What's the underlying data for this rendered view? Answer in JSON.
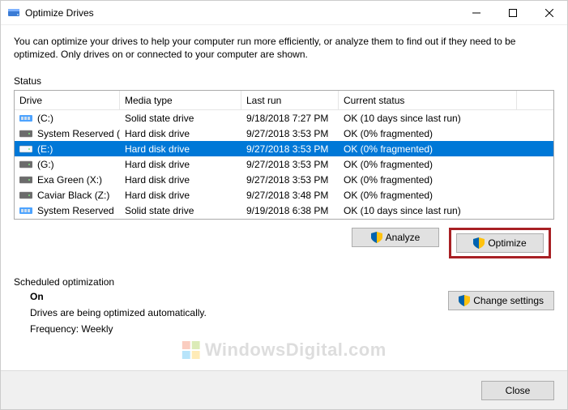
{
  "window": {
    "title": "Optimize Drives"
  },
  "description": "You can optimize your drives to help your computer run more efficiently, or analyze them to find out if they need to be optimized. Only drives on or connected to your computer are shown.",
  "status_label": "Status",
  "columns": {
    "drive": "Drive",
    "media": "Media type",
    "last": "Last run",
    "status": "Current status"
  },
  "rows": [
    {
      "icon": "ssd",
      "drive": "(C:)",
      "media": "Solid state drive",
      "last": "9/18/2018 7:27 PM",
      "status": "OK (10 days since last run)",
      "selected": false
    },
    {
      "icon": "hdd",
      "drive": "System Reserved (D:)",
      "media": "Hard disk drive",
      "last": "9/27/2018 3:53 PM",
      "status": "OK (0% fragmented)",
      "selected": false
    },
    {
      "icon": "hdd",
      "drive": "(E:)",
      "media": "Hard disk drive",
      "last": "9/27/2018 3:53 PM",
      "status": "OK (0% fragmented)",
      "selected": true
    },
    {
      "icon": "hdd",
      "drive": "(G:)",
      "media": "Hard disk drive",
      "last": "9/27/2018 3:53 PM",
      "status": "OK (0% fragmented)",
      "selected": false
    },
    {
      "icon": "hdd",
      "drive": "Exa Green (X:)",
      "media": "Hard disk drive",
      "last": "9/27/2018 3:53 PM",
      "status": "OK (0% fragmented)",
      "selected": false
    },
    {
      "icon": "hdd",
      "drive": "Caviar Black (Z:)",
      "media": "Hard disk drive",
      "last": "9/27/2018 3:48 PM",
      "status": "OK (0% fragmented)",
      "selected": false
    },
    {
      "icon": "ssd",
      "drive": "System Reserved",
      "media": "Solid state drive",
      "last": "9/19/2018 6:38 PM",
      "status": "OK (10 days since last run)",
      "selected": false
    }
  ],
  "buttons": {
    "analyze": "Analyze",
    "optimize": "Optimize",
    "change_settings": "Change settings",
    "close": "Close"
  },
  "scheduled": {
    "label": "Scheduled optimization",
    "state": "On",
    "line1": "Drives are being optimized automatically.",
    "line2": "Frequency: Weekly"
  },
  "watermark": "WindowsDigital.com"
}
